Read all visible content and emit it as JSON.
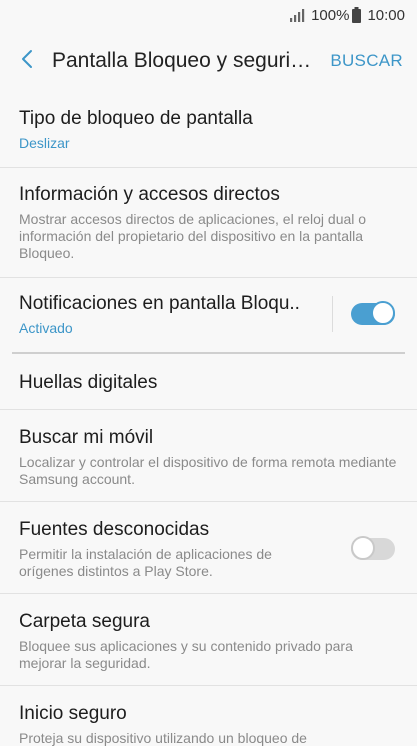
{
  "status": {
    "battery": "100%",
    "time": "10:00"
  },
  "header": {
    "title": "Pantalla Bloqueo y segurid...",
    "search_label": "BUSCAR"
  },
  "items": [
    {
      "title": "Tipo de bloqueo de pantalla",
      "subtitle": "Deslizar"
    },
    {
      "title": "Información y accesos directos",
      "subtitle": "Mostrar accesos directos de aplicaciones, el reloj dual o información del propietario del dispositivo en la pantalla Bloqueo."
    },
    {
      "title": "Notificaciones en pantalla Bloqu..",
      "subtitle": "Activado",
      "toggle": true
    },
    {
      "title": "Huellas digitales"
    },
    {
      "title": "Buscar mi móvil",
      "subtitle": "Localizar y controlar el dispositivo de forma remota mediante Samsung account."
    },
    {
      "title": "Fuentes desconocidas",
      "subtitle": "Permitir la instalación de aplicaciones de orígenes distintos a Play Store.",
      "toggle": false
    },
    {
      "title": "Carpeta segura",
      "subtitle": "Bloquee sus aplicaciones y su contenido privado para mejorar la seguridad."
    },
    {
      "title": "Inicio seguro",
      "subtitle": "Proteja su dispositivo utilizando un bloqueo de"
    }
  ],
  "colors": {
    "accent": "#3d96c8",
    "toggle_on": "#4a9fd1"
  }
}
